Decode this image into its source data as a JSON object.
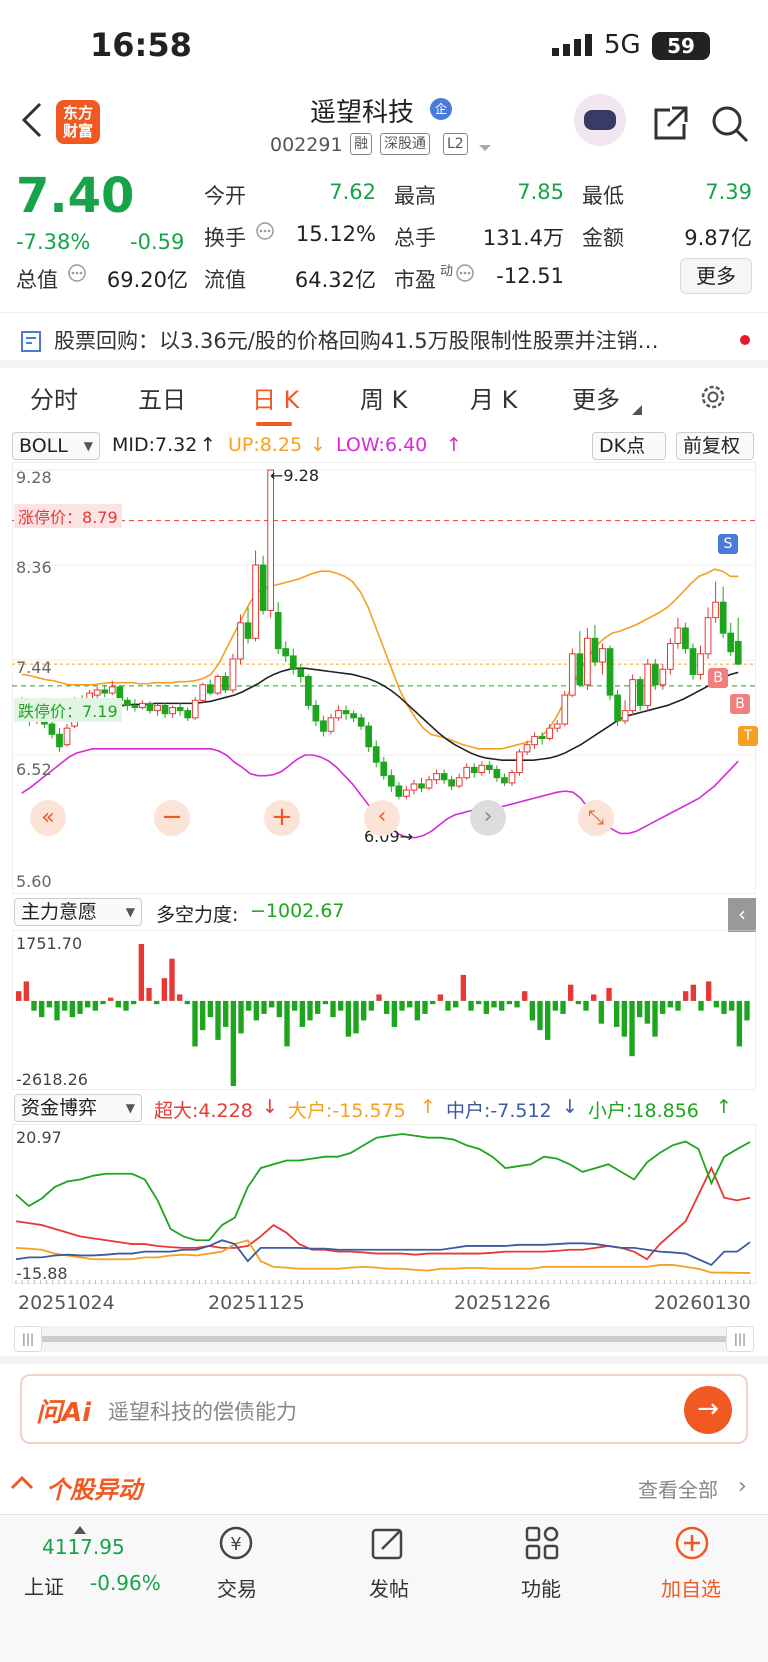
{
  "status": {
    "time": "16:58",
    "network": "5G",
    "battery": "59"
  },
  "header": {
    "logo": "东方财富",
    "title": "遥望科技",
    "title_badge": "企",
    "code": "002291",
    "tags": [
      "融",
      "深股通",
      "L2"
    ]
  },
  "quote": {
    "price": "7.40",
    "change_pct": "-7.38%",
    "change": "-0.59",
    "rows": [
      [
        {
          "l": "今开",
          "v": "7.62",
          "c": "green"
        },
        {
          "l": "最高",
          "v": "7.85",
          "c": "green"
        },
        {
          "l": "最低",
          "v": "7.39",
          "c": "green"
        }
      ],
      [
        {
          "l": "换手",
          "v": "15.12%",
          "c": ""
        },
        {
          "l": "总手",
          "v": "131.4万",
          "c": ""
        },
        {
          "l": "金额",
          "v": "9.87亿",
          "c": ""
        }
      ],
      [
        {
          "l": "流值",
          "v": "64.32亿",
          "c": ""
        },
        {
          "l": "市盈",
          "v": "-12.51",
          "c": ""
        }
      ]
    ],
    "total_label": "总值",
    "total_value": "69.20亿",
    "pe_sup": "动",
    "more": "更多"
  },
  "news": {
    "text": "股票回购：以3.36元/股的价格回购41.5万股限制性股票并注销…"
  },
  "tabs": [
    "分时",
    "五日",
    "日 K",
    "周 K",
    "月 K",
    "更多"
  ],
  "indicator": {
    "name": "BOLL",
    "mid": "MID:7.32",
    "up": "UP:8.25",
    "low": "LOW:6.40",
    "dk": "DK点",
    "adj": "前复权"
  },
  "chart": {
    "y_labels": [
      "9.28",
      "8.36",
      "7.44",
      "6.52",
      "5.60"
    ],
    "limit_up_label": "涨停价：",
    "limit_up": "8.79",
    "limit_down_label": "跌停价：",
    "limit_down": "7.19",
    "high_mark": "9.28",
    "low_mark": "6.09",
    "markers": [
      "S",
      "B",
      "B",
      "T"
    ],
    "colors": {
      "up": "#e53935",
      "down": "#1ea51e",
      "mid": "#222222",
      "upper": "#f5a020",
      "lower": "#d62bd6"
    }
  },
  "sub1": {
    "name": "主力意愿",
    "label": "多空力度:",
    "value": "−1002.67",
    "top": "1751.70",
    "bottom": "-2618.26"
  },
  "sub2": {
    "name": "资金博弈",
    "s1": "超大:4.228",
    "s2": "大户:-15.575",
    "s3": "中户:-7.512",
    "s4": "小户:18.856",
    "top": "20.97",
    "bottom": "-15.88"
  },
  "dates": [
    "20251024",
    "20251125",
    "20251226",
    "20260130"
  ],
  "ai": {
    "brand": "问Ai",
    "placeholder": "遥望科技的偿债能力"
  },
  "section": {
    "title": "个股异动",
    "link": "查看全部"
  },
  "bottom": {
    "index_value": "4117.95",
    "index_name": "上证",
    "index_change": "-0.96%",
    "items": [
      "交易",
      "发帖",
      "功能",
      "加自选"
    ]
  },
  "chart_data": {
    "type": "candlestick",
    "ylim": [
      5.6,
      9.28
    ],
    "x_ticks": [
      "20251024",
      "20251125",
      "20251226",
      "20260130"
    ],
    "candles": [
      [
        7.0,
        6.92,
        7.08,
        6.85
      ],
      [
        6.9,
        6.85,
        6.98,
        6.8
      ],
      [
        6.85,
        6.98,
        7.02,
        6.82
      ],
      [
        6.95,
        6.82,
        6.98,
        6.78
      ],
      [
        6.82,
        6.72,
        6.9,
        6.68
      ],
      [
        6.72,
        6.6,
        6.78,
        6.55
      ],
      [
        6.62,
        6.78,
        6.82,
        6.6
      ],
      [
        6.8,
        7.05,
        7.08,
        6.78
      ],
      [
        7.05,
        7.02,
        7.1,
        6.98
      ],
      [
        7.0,
        7.12,
        7.15,
        6.98
      ],
      [
        7.1,
        7.15,
        7.18,
        7.02
      ],
      [
        7.15,
        7.12,
        7.2,
        7.08
      ],
      [
        7.12,
        7.18,
        7.24,
        7.1
      ],
      [
        7.18,
        7.05,
        7.2,
        7.0
      ],
      [
        7.05,
        7.0,
        7.08,
        6.95
      ],
      [
        7.0,
        6.98,
        7.06,
        6.94
      ],
      [
        6.98,
        7.02,
        7.05,
        6.96
      ],
      [
        7.02,
        6.95,
        7.04,
        6.92
      ],
      [
        6.95,
        7.0,
        7.02,
        6.9
      ],
      [
        7.0,
        6.92,
        7.03,
        6.88
      ],
      [
        6.92,
        6.98,
        7.0,
        6.88
      ],
      [
        6.98,
        6.95,
        7.02,
        6.9
      ],
      [
        6.95,
        6.88,
        6.98,
        6.85
      ],
      [
        6.88,
        7.05,
        7.08,
        6.86
      ],
      [
        7.05,
        7.2,
        7.22,
        7.02
      ],
      [
        7.2,
        7.12,
        7.25,
        7.1
      ],
      [
        7.12,
        7.28,
        7.3,
        7.1
      ],
      [
        7.28,
        7.15,
        7.32,
        7.12
      ],
      [
        7.15,
        7.45,
        7.5,
        7.12
      ],
      [
        7.45,
        7.8,
        7.88,
        7.4
      ],
      [
        7.8,
        7.65,
        7.95,
        7.6
      ],
      [
        7.65,
        8.36,
        8.5,
        7.62
      ],
      [
        8.36,
        7.92,
        8.45,
        7.88
      ],
      [
        7.92,
        9.28,
        9.28,
        7.85
      ],
      [
        7.9,
        7.55,
        8.0,
        7.5
      ],
      [
        7.55,
        7.48,
        7.62,
        7.42
      ],
      [
        7.48,
        7.35,
        7.55,
        7.3
      ],
      [
        7.35,
        7.28,
        7.4,
        7.22
      ],
      [
        7.28,
        7.0,
        7.3,
        6.96
      ],
      [
        7.0,
        6.85,
        7.05,
        6.8
      ],
      [
        6.85,
        6.75,
        6.9,
        6.7
      ],
      [
        6.75,
        6.88,
        6.92,
        6.72
      ],
      [
        6.88,
        6.95,
        7.0,
        6.85
      ],
      [
        6.95,
        6.92,
        7.0,
        6.86
      ],
      [
        6.92,
        6.88,
        6.95,
        6.84
      ],
      [
        6.88,
        6.8,
        6.92,
        6.76
      ],
      [
        6.8,
        6.6,
        6.84,
        6.55
      ],
      [
        6.6,
        6.45,
        6.66,
        6.4
      ],
      [
        6.45,
        6.32,
        6.5,
        6.28
      ],
      [
        6.32,
        6.22,
        6.38,
        6.16
      ],
      [
        6.22,
        6.12,
        6.26,
        6.09
      ],
      [
        6.12,
        6.18,
        6.22,
        6.09
      ],
      [
        6.18,
        6.24,
        6.28,
        6.14
      ],
      [
        6.24,
        6.2,
        6.3,
        6.16
      ],
      [
        6.2,
        6.28,
        6.32,
        6.18
      ],
      [
        6.28,
        6.34,
        6.38,
        6.24
      ],
      [
        6.34,
        6.28,
        6.38,
        6.24
      ],
      [
        6.28,
        6.22,
        6.32,
        6.18
      ],
      [
        6.22,
        6.3,
        6.34,
        6.2
      ],
      [
        6.3,
        6.4,
        6.44,
        6.28
      ],
      [
        6.4,
        6.35,
        6.44,
        6.3
      ],
      [
        6.35,
        6.42,
        6.46,
        6.32
      ],
      [
        6.42,
        6.38,
        6.46,
        6.34
      ],
      [
        6.38,
        6.3,
        6.42,
        6.26
      ],
      [
        6.3,
        6.25,
        6.34,
        6.22
      ],
      [
        6.25,
        6.35,
        6.38,
        6.22
      ],
      [
        6.35,
        6.55,
        6.58,
        6.32
      ],
      [
        6.55,
        6.62,
        6.66,
        6.52
      ],
      [
        6.62,
        6.7,
        6.74,
        6.58
      ],
      [
        6.7,
        6.68,
        6.74,
        6.62
      ],
      [
        6.68,
        6.78,
        6.82,
        6.66
      ],
      [
        6.78,
        6.82,
        6.86,
        6.74
      ],
      [
        6.82,
        7.1,
        7.14,
        6.8
      ],
      [
        7.1,
        7.5,
        7.55,
        7.08
      ],
      [
        7.5,
        7.2,
        7.72,
        7.18
      ],
      [
        7.2,
        7.65,
        7.75,
        7.15
      ],
      [
        7.65,
        7.42,
        7.78,
        7.38
      ],
      [
        7.42,
        7.55,
        7.6,
        7.3
      ],
      [
        7.55,
        7.1,
        7.58,
        7.05
      ],
      [
        7.1,
        6.85,
        7.15,
        6.8
      ],
      [
        6.85,
        6.95,
        7.05,
        6.82
      ],
      [
        6.95,
        7.25,
        7.3,
        6.9
      ],
      [
        7.25,
        7.0,
        7.28,
        6.95
      ],
      [
        7.0,
        7.4,
        7.45,
        6.95
      ],
      [
        7.4,
        7.2,
        7.45,
        7.15
      ],
      [
        7.2,
        7.35,
        7.4,
        7.15
      ],
      [
        7.35,
        7.6,
        7.65,
        7.3
      ],
      [
        7.6,
        7.75,
        7.85,
        7.55
      ],
      [
        7.75,
        7.55,
        7.8,
        7.5
      ],
      [
        7.55,
        7.3,
        7.6,
        7.25
      ],
      [
        7.3,
        7.5,
        7.58,
        7.25
      ],
      [
        7.5,
        7.85,
        7.95,
        7.45
      ],
      [
        7.85,
        8.0,
        8.2,
        7.8
      ],
      [
        8.0,
        7.7,
        8.15,
        7.65
      ],
      [
        7.7,
        7.52,
        7.8,
        7.48
      ],
      [
        7.62,
        7.4,
        7.85,
        7.39
      ]
    ],
    "mid": [
      6.98,
      6.97,
      6.96,
      6.95,
      6.95,
      6.94,
      6.94,
      6.95,
      6.96,
      6.97,
      6.98,
      6.99,
      7.0,
      7.0,
      7.01,
      7.01,
      7.01,
      7.02,
      7.02,
      7.02,
      7.02,
      7.02,
      7.02,
      7.03,
      7.04,
      7.06,
      7.08,
      7.1,
      7.13,
      7.17,
      7.21,
      7.26,
      7.3,
      7.33,
      7.35,
      7.36,
      7.36,
      7.35,
      7.34,
      7.33,
      7.32,
      7.31,
      7.3,
      7.28,
      7.26,
      7.23,
      7.19,
      7.14,
      7.08,
      7.01,
      6.94,
      6.87,
      6.8,
      6.73,
      6.67,
      6.62,
      6.58,
      6.54,
      6.51,
      6.49,
      6.48,
      6.47,
      6.47,
      6.47,
      6.47,
      6.47,
      6.48,
      6.49,
      6.51,
      6.54,
      6.58,
      6.62,
      6.67,
      6.72,
      6.77,
      6.82,
      6.87,
      6.9,
      6.92,
      6.94,
      6.96,
      6.98,
      7.0,
      7.03,
      7.06,
      7.1,
      7.14,
      7.18,
      7.22,
      7.26,
      7.3,
      7.32
    ],
    "upper": [
      7.3,
      7.29,
      7.27,
      7.25,
      7.24,
      7.22,
      7.2,
      7.2,
      7.2,
      7.2,
      7.21,
      7.22,
      7.22,
      7.22,
      7.22,
      7.21,
      7.21,
      7.22,
      7.22,
      7.22,
      7.23,
      7.23,
      7.24,
      7.26,
      7.3,
      7.4,
      7.55,
      7.7,
      7.85,
      8.0,
      8.1,
      8.14,
      8.16,
      8.18,
      8.2,
      8.22,
      8.25,
      8.28,
      8.3,
      8.3,
      8.28,
      8.25,
      8.2,
      8.1,
      7.95,
      7.75,
      7.55,
      7.35,
      7.15,
      7.0,
      6.88,
      6.78,
      6.72,
      6.7,
      6.68,
      6.65,
      6.62,
      6.6,
      6.58,
      6.58,
      6.58,
      6.58,
      6.6,
      6.62,
      6.64,
      6.66,
      6.7,
      6.78,
      6.9,
      7.05,
      7.2,
      7.35,
      7.48,
      7.58,
      7.65,
      7.7,
      7.72,
      7.75,
      7.78,
      7.82,
      7.86,
      7.9,
      7.95,
      8.02,
      8.1,
      8.18,
      8.25,
      8.28,
      8.32,
      8.3,
      8.25,
      8.25
    ],
    "lower": [
      6.15,
      6.2,
      6.26,
      6.32,
      6.38,
      6.44,
      6.5,
      6.54,
      6.56,
      6.58,
      6.58,
      6.58,
      6.58,
      6.58,
      6.58,
      6.58,
      6.58,
      6.58,
      6.58,
      6.58,
      6.58,
      6.58,
      6.58,
      6.58,
      6.58,
      6.56,
      6.52,
      6.45,
      6.4,
      6.34,
      6.32,
      6.32,
      6.33,
      6.36,
      6.42,
      6.48,
      6.52,
      6.52,
      6.5,
      6.46,
      6.4,
      6.32,
      6.24,
      6.14,
      6.04,
      5.94,
      5.86,
      5.8,
      5.75,
      5.72,
      5.72,
      5.74,
      5.78,
      5.84,
      5.9,
      5.94,
      5.96,
      5.98,
      5.99,
      6.0,
      6.01,
      6.02,
      6.04,
      6.06,
      6.08,
      6.1,
      6.12,
      6.14,
      6.16,
      6.17,
      6.16,
      6.1,
      6.0,
      5.92,
      5.86,
      5.8,
      5.76,
      5.76,
      5.78,
      5.82,
      5.86,
      5.9,
      5.94,
      5.98,
      6.02,
      6.06,
      6.1,
      6.16,
      6.22,
      6.3,
      6.38,
      6.46
    ],
    "sub1_values": [
      300,
      600,
      -300,
      -500,
      -200,
      -600,
      -300,
      -500,
      -400,
      -200,
      -300,
      -100,
      100,
      -200,
      -300,
      -100,
      1751,
      400,
      -100,
      700,
      1300,
      200,
      -100,
      -1400,
      -900,
      -500,
      -1200,
      -800,
      -2618,
      -1000,
      -300,
      -600,
      -400,
      -200,
      -500,
      -1400,
      -300,
      -800,
      -600,
      -400,
      -100,
      -500,
      -300,
      -1100,
      -1000,
      -600,
      -300,
      200,
      -400,
      -800,
      -300,
      -200,
      -600,
      -400,
      -100,
      200,
      -300,
      -200,
      800,
      -300,
      -100,
      -400,
      -200,
      -300,
      -100,
      -200,
      300,
      -600,
      -900,
      -1200,
      -300,
      -400,
      500,
      -100,
      -300,
      200,
      -700,
      400,
      -800,
      -1100,
      -1700,
      -500,
      -700,
      -1100,
      -400,
      -200,
      -300,
      300,
      500,
      -300,
      600,
      -200,
      -400,
      -300,
      -1400,
      -600
    ],
    "sub2_series": [
      {
        "name": "超大",
        "color": "#e53935",
        "values": [
          -2,
          -2.5,
          -3,
          -4,
          -5,
          -6,
          -6.5,
          -7,
          -7.5,
          -8,
          -8,
          -8.5,
          -8.8,
          -9,
          -9,
          -8.5,
          -9,
          -9,
          -8.5,
          -6,
          -3,
          -5,
          -8,
          -9.5,
          -9.5,
          -10,
          -10,
          -10.2,
          -10.5,
          -10.5,
          -10.5,
          -10.8,
          -10.5,
          -10.5,
          -10.5,
          -10.5,
          -10.5,
          -10.3,
          -10,
          -10,
          -10,
          -10,
          -9.8,
          -9.5,
          -9.5,
          -9,
          -8.5,
          -9,
          -10,
          -12,
          -8,
          -5,
          -2,
          5,
          12,
          4.2,
          3.5,
          4.2
        ]
      },
      {
        "name": "大户",
        "color": "#f5a020",
        "values": [
          -9,
          -9.2,
          -9.5,
          -10.5,
          -11,
          -11.5,
          -12,
          -12,
          -12,
          -12,
          -11.5,
          -11.5,
          -11,
          -10.8,
          -11,
          -10.5,
          -10,
          -8,
          -7,
          -12.5,
          -14,
          -14.2,
          -14.5,
          -14.5,
          -14.5,
          -14.5,
          -14.2,
          -14,
          -14.2,
          -14.5,
          -14.5,
          -14.8,
          -15,
          -14.5,
          -14.5,
          -14.3,
          -14.3,
          -14.5,
          -14.5,
          -14.5,
          -14.5,
          -14,
          -14,
          -14,
          -14,
          -14,
          -14,
          -14,
          -14,
          -14,
          -13.5,
          -13.5,
          -14,
          -14.5,
          -15.5,
          -15.5,
          -15.575,
          -15.6
        ]
      },
      {
        "name": "中户",
        "color": "#3b5aa0",
        "values": [
          -12,
          -11.5,
          -11.5,
          -11,
          -10.8,
          -11,
          -11,
          -10.8,
          -10.5,
          -10.5,
          -10,
          -10,
          -10,
          -9.5,
          -9.5,
          -8.5,
          -7,
          -8,
          -12.5,
          -9,
          -9,
          -9,
          -9,
          -9.2,
          -9.2,
          -9.5,
          -9.5,
          -9.5,
          -9.5,
          -9.5,
          -9.5,
          -9.5,
          -9.5,
          -9.5,
          -9,
          -8.5,
          -8.5,
          -8.5,
          -8.5,
          -8.2,
          -8.2,
          -8.2,
          -8,
          -7.8,
          -7.8,
          -8,
          -8.5,
          -9,
          -9,
          -9.5,
          -10,
          -10.2,
          -10.5,
          -12,
          -13.5,
          -10,
          -10,
          -7.512
        ]
      },
      {
        "name": "小户",
        "color": "#1ea51e",
        "values": [
          5,
          2,
          4,
          7,
          8.5,
          9,
          10,
          10.5,
          10.5,
          10.5,
          9,
          3.5,
          -4,
          -6,
          -7,
          -7,
          -3,
          -1,
          7,
          12,
          13,
          14,
          14,
          14.5,
          15,
          15,
          16,
          18,
          20,
          20.5,
          20.97,
          20.5,
          20,
          20,
          19.5,
          18,
          17,
          15,
          12,
          12.5,
          13,
          15,
          14.5,
          13,
          11,
          12,
          13,
          11,
          9,
          13.5,
          16,
          18,
          19,
          17,
          8,
          15,
          17,
          18.856
        ]
      }
    ]
  }
}
